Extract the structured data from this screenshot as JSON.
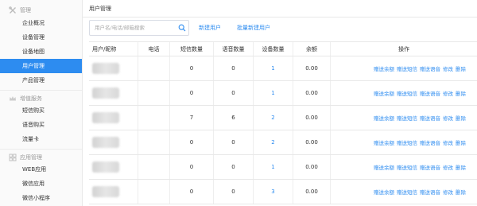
{
  "sidebar": {
    "groups": [
      {
        "label": "管理",
        "icon": "wrench-icon",
        "items": [
          "企业概况",
          "设备管理",
          "设备地图",
          "用户管理",
          "产品管理"
        ]
      },
      {
        "label": "增值服务",
        "icon": "crown-icon",
        "items": [
          "短信购买",
          "语音购买",
          "流量卡"
        ]
      },
      {
        "label": "应用管理",
        "icon": "grid-icon",
        "items": [
          "WEB应用",
          "微信应用",
          "微信小程序"
        ]
      }
    ],
    "active_item": "用户管理"
  },
  "breadcrumb": "用户管理",
  "toolbar": {
    "search_placeholder": "用户名/电话/邮箱搜索",
    "new_user": "新建用户",
    "batch_new_user": "批量新建用户"
  },
  "table": {
    "headers": [
      "用户/昵称",
      "电话",
      "短信数量",
      "语音数量",
      "设备数量",
      "余额",
      "操作"
    ],
    "rows": [
      {
        "sms": "0",
        "voice": "0",
        "devices": "1",
        "balance": "0.00"
      },
      {
        "sms": "0",
        "voice": "0",
        "devices": "1",
        "balance": "0.00"
      },
      {
        "sms": "7",
        "voice": "6",
        "devices": "2",
        "balance": "0.00"
      },
      {
        "sms": "0",
        "voice": "0",
        "devices": "2",
        "balance": "0.00"
      },
      {
        "sms": "0",
        "voice": "0",
        "devices": "1",
        "balance": "0.00"
      },
      {
        "sms": "0",
        "voice": "0",
        "devices": "3",
        "balance": "0.00"
      }
    ],
    "actions": [
      "赠送余额",
      "赠送短信",
      "赠送语音",
      "修改",
      "删除"
    ]
  },
  "colors": {
    "accent": "#2d8cf0"
  }
}
